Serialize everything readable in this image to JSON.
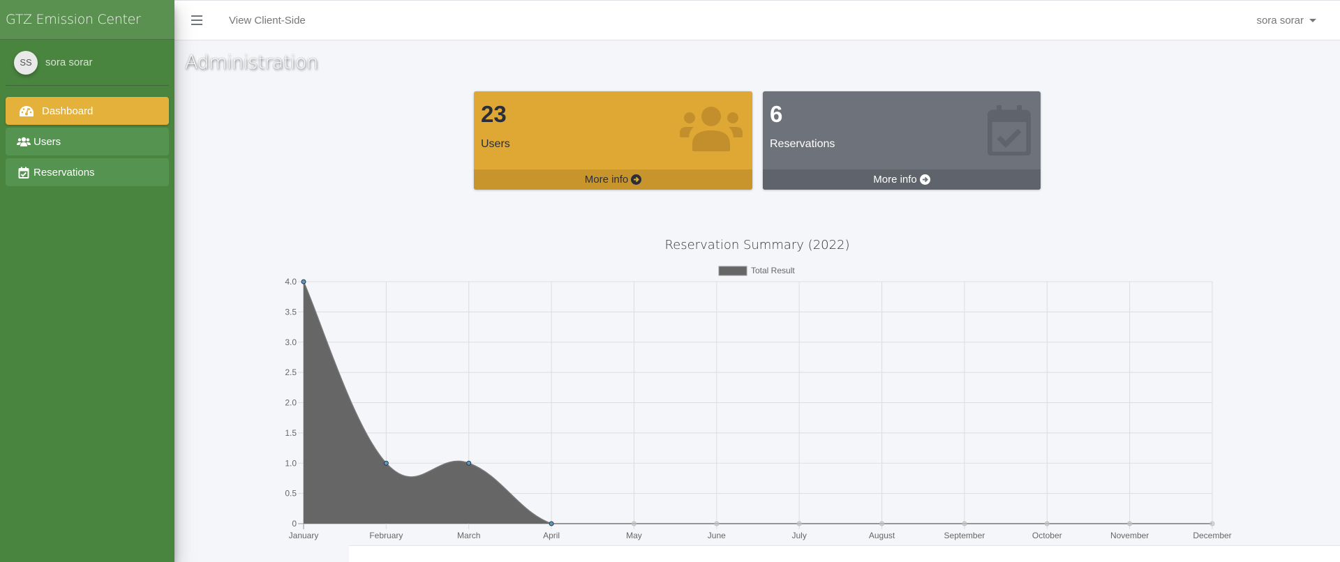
{
  "app": {
    "brand": "GTZ Emission Center",
    "page_title": "Administration"
  },
  "sidebar": {
    "user": {
      "initials": "SS",
      "name": "sora sorar"
    },
    "items": [
      {
        "label": "Dashboard",
        "icon": "tachometer-icon",
        "active": true
      },
      {
        "label": "Users",
        "icon": "users-icon",
        "active": false
      },
      {
        "label": "Reservations",
        "icon": "calendar-check-icon",
        "active": false
      }
    ]
  },
  "topbar": {
    "menu_icon": "hamburger-icon",
    "client_link": "View Client-Side",
    "user_menu": "sora sorar"
  },
  "cards": [
    {
      "value": "23",
      "label": "Users",
      "footer": "More info",
      "icon": "users-icon",
      "color": "#dfa733"
    },
    {
      "value": "6",
      "label": "Reservations",
      "footer": "More info",
      "icon": "calendar-check-icon",
      "color": "#6e727b"
    }
  ],
  "chart_data": {
    "type": "area",
    "title": "Reservation Summary (2022)",
    "categories": [
      "January",
      "February",
      "March",
      "April",
      "May",
      "June",
      "July",
      "August",
      "September",
      "October",
      "November",
      "December"
    ],
    "series": [
      {
        "name": "Total Result",
        "values": [
          4,
          1,
          1,
          0,
          0,
          0,
          0,
          0,
          0,
          0,
          0,
          0
        ],
        "color": "#666666"
      }
    ],
    "y_ticks": [
      "0",
      "0.5",
      "1.0",
      "1.5",
      "2.0",
      "2.5",
      "3.0",
      "3.5",
      "4.0"
    ],
    "ylim": [
      0,
      4
    ],
    "xlabel": "",
    "ylabel": "",
    "grid": true,
    "legend": "top-center",
    "smooth": true,
    "point_color": "#5a9bb8"
  }
}
